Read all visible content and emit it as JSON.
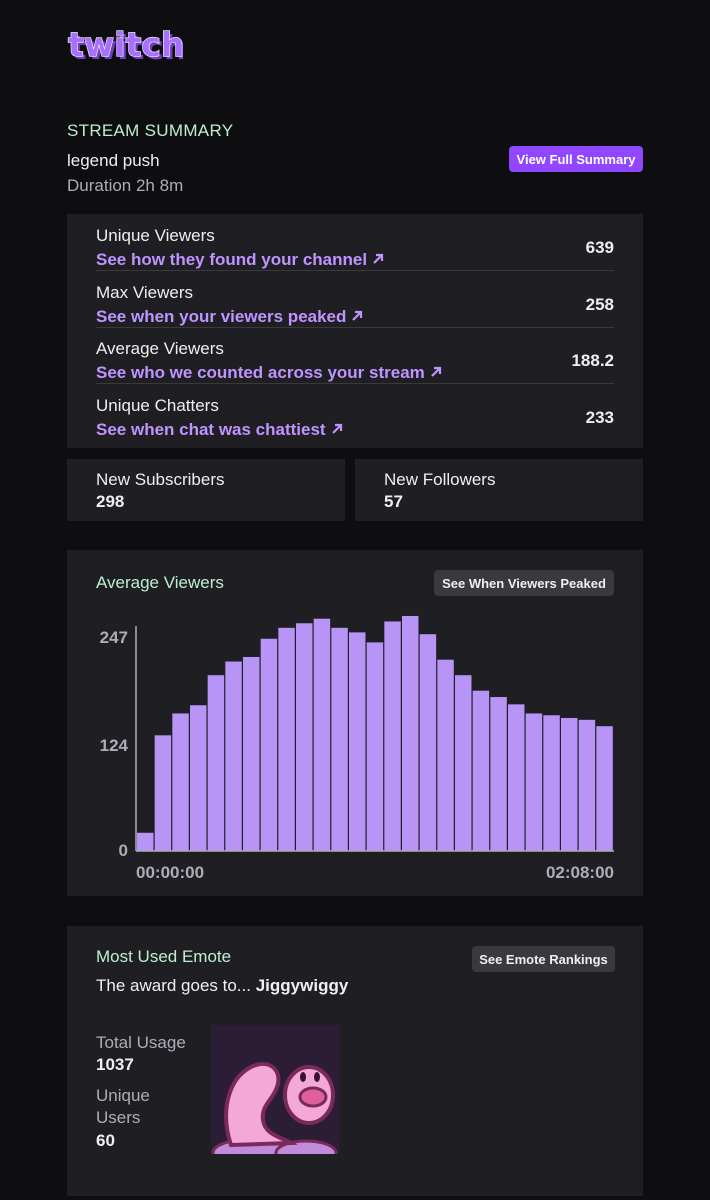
{
  "brand": {
    "logo_text": "twitch",
    "accent": "#9147ff"
  },
  "summary": {
    "heading": "STREAM SUMMARY",
    "stream_name": "legend push",
    "duration": "Duration 2h 8m",
    "view_full_label": "View Full Summary"
  },
  "stats": [
    {
      "label": "Unique Viewers",
      "link": "See how they found your channel",
      "value": "639"
    },
    {
      "label": "Max Viewers",
      "link": "See when your viewers peaked",
      "value": "258"
    },
    {
      "label": "Average Viewers",
      "link": "See who we counted across your stream",
      "value": "188.2"
    },
    {
      "label": "Unique Chatters",
      "link": "See when chat was chattiest",
      "value": "233"
    }
  ],
  "subscribers": {
    "label": "New Subscribers",
    "value": "298"
  },
  "followers": {
    "label": "New Followers",
    "value": "57"
  },
  "chart_section": {
    "heading": "Average Viewers",
    "button_label": "See When Viewers Peaked"
  },
  "chart_data": {
    "type": "bar",
    "title": "Average Viewers",
    "y_ticks": [
      "247",
      "124",
      "0"
    ],
    "x_ticks": [
      "00:00:00",
      "02:08:00"
    ],
    "ylim": [
      0,
      247
    ],
    "bar_color": "#b794f6",
    "values": [
      20,
      127,
      151,
      160,
      193,
      208,
      213,
      233,
      245,
      250,
      255,
      245,
      240,
      229,
      252,
      258,
      238,
      210,
      193,
      176,
      169,
      161,
      151,
      149,
      146,
      144,
      137
    ]
  },
  "emote": {
    "heading": "Most Used Emote",
    "button_label": "See Emote Rankings",
    "award_prefix": "The award goes to...",
    "emote_name": "Jiggywiggy",
    "total_usage_label": "Total Usage",
    "total_usage_value": "1037",
    "unique_users_label": "Unique Users",
    "unique_users_value": "60"
  }
}
